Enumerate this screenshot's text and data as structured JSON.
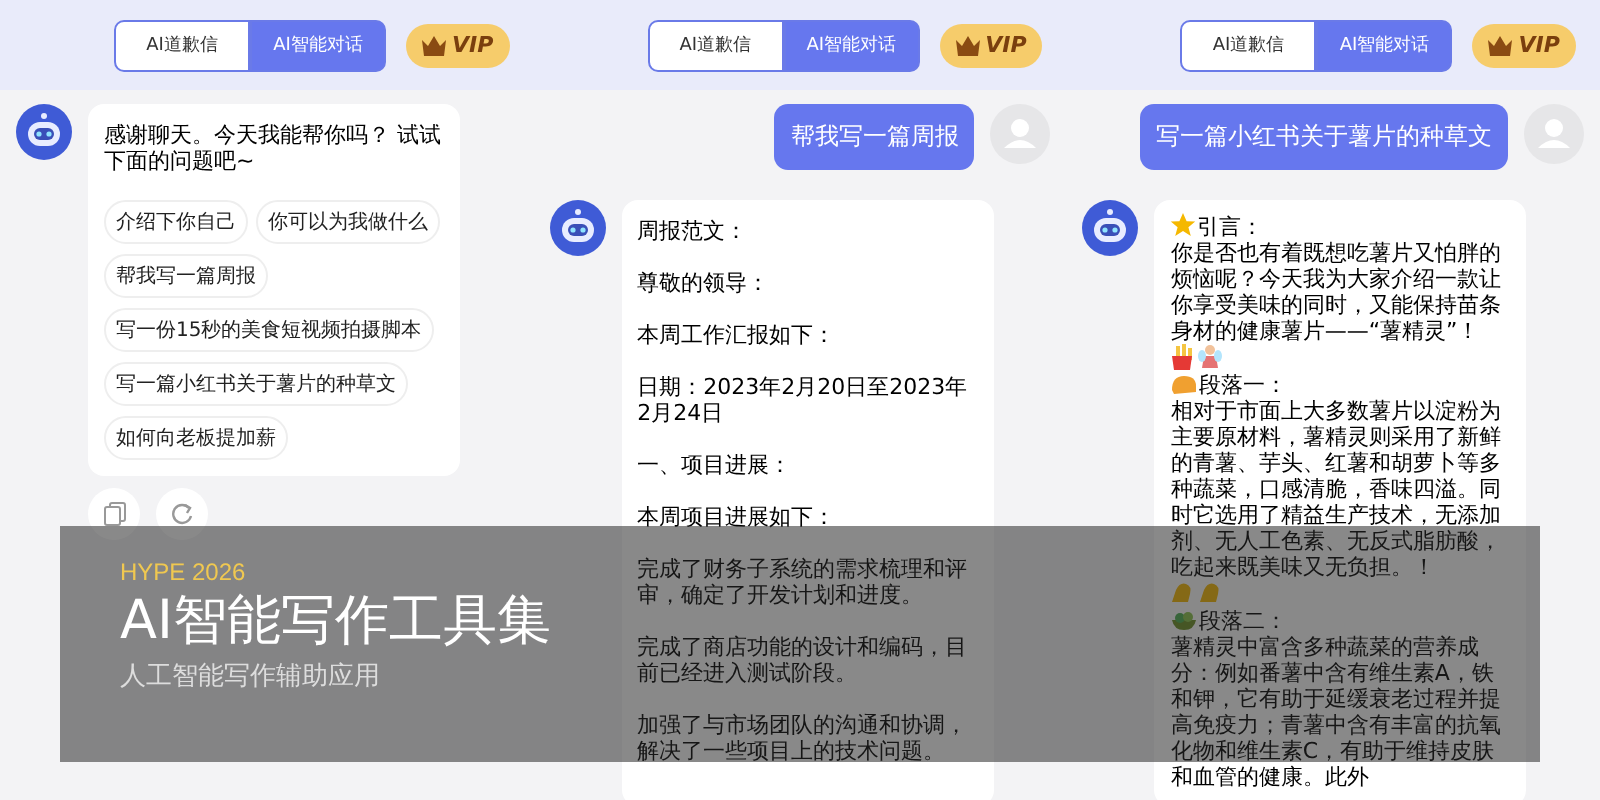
{
  "panels": [
    {
      "tabs": [
        {
          "label": "AI道歉信",
          "selected": false
        },
        {
          "label": "AI智能对话",
          "selected": true
        }
      ],
      "vip": "VIP",
      "messages": [
        {
          "kind": "bot",
          "paragraphs": [
            {
              "text": "感谢聊天。今天我能帮你吗？ 试试下面的问题吧~"
            }
          ],
          "suggestions": [
            "介绍下你自己",
            "你可以为我做什么",
            "帮我写一篇周报",
            "写一份15秒的美食短视频拍摄脚本",
            "写一篇小红书关于薯片的种草文",
            "如何向老板提加薪"
          ]
        }
      ]
    },
    {
      "tabs": [
        {
          "label": "AI道歉信",
          "selected": false
        },
        {
          "label": "AI智能对话",
          "selected": true
        }
      ],
      "vip": "VIP",
      "messages": [
        {
          "kind": "user",
          "paragraphs": [
            {
              "text": "帮我写一篇周报"
            }
          ]
        },
        {
          "kind": "bot",
          "paragraphs": [
            {
              "text": "周报范文："
            },
            {
              "text": "尊敬的领导："
            },
            {
              "text": "本周工作汇报如下："
            },
            {
              "text": "日期：2023年2月20日至2023年2月24日"
            },
            {
              "text": "一、项目进展："
            },
            {
              "text": "本周项目进展如下："
            },
            {
              "text": "完成了财务子系统的需求梳理和评审，确定了开发计划和进度。"
            },
            {
              "text": "完成了商店功能的设计和编码，目前已经进入测试阶段。"
            },
            {
              "text": "加强了与市场团队的沟通和协调，解决了一些项目上的技术问题。"
            }
          ]
        }
      ]
    },
    {
      "tabs": [
        {
          "label": "AI道歉信",
          "selected": false
        },
        {
          "label": "AI智能对话",
          "selected": true
        }
      ],
      "vip": "VIP",
      "messages": [
        {
          "kind": "user",
          "paragraphs": [
            {
              "text": "写一篇小红书关于薯片的种草文"
            }
          ]
        },
        {
          "kind": "bot",
          "paragraphs": [
            {
              "kind": "heading",
              "text": "引言："
            },
            {
              "kind": "body",
              "text": "你是否也有着既想吃薯片又怕胖的烦恼呢？今天我为大家介绍一款让你享受美味的同时，又能保持苗条身材的健康薯片——“薯精灵”！"
            },
            {
              "kind": "heading",
              "text": "段落一："
            },
            {
              "kind": "body",
              "text": "相对于市面上大多数薯片以淀粉为主要原材料，薯精灵则采用了新鲜的青薯、芋头、红薯和胡萝卜等多种蔬菜，口感清脆，香味四溢。同时它选用了精益生产技术，无添加剂、无人工色素、无反式脂肪酸，吃起来既美味又无负担。！"
            },
            {
              "kind": "heading",
              "text": "段落二："
            },
            {
              "kind": "body",
              "text": "薯精灵中富含多种蔬菜的营养成分：例如番薯中含有维生素A，铁和钾，它有助于延缓衰老过程并提高免疫力；青薯中含有丰富的抗氧化物和维生素C，有助于维持皮肤和血管的健康。此外"
            }
          ]
        }
      ]
    }
  ],
  "banner": {
    "kicker": "HYPE 2026",
    "title": "AI智能写作工具集",
    "subtitle": "人工智能写作辅助应用"
  }
}
